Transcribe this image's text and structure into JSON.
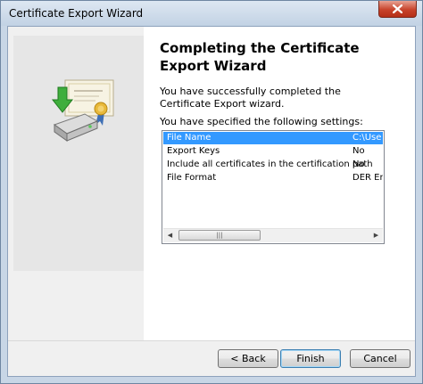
{
  "window": {
    "title": "Certificate Export Wizard"
  },
  "wizard": {
    "heading": "Completing the Certificate Export Wizard",
    "description": "You have successfully completed the Certificate Export wizard.",
    "settings_label": "You have specified the following settings:",
    "settings": [
      {
        "name": "File Name",
        "value": "C:\\Use"
      },
      {
        "name": "Export Keys",
        "value": "No"
      },
      {
        "name": "Include all certificates in the certification path",
        "value": "No"
      },
      {
        "name": "File Format",
        "value": "DER En"
      }
    ],
    "selected_row": 0,
    "scroll_thumb_grip": "|||"
  },
  "buttons": {
    "back": "< Back",
    "finish": "Finish",
    "cancel": "Cancel"
  },
  "icons": {
    "close": "close-icon",
    "wizard": "certificate-export-icon",
    "scroll_left": "left-arrow-icon",
    "scroll_right": "right-arrow-icon"
  },
  "colors": {
    "selection": "#3399ff",
    "close_button": "#c7432b",
    "panel": "#e6e6e6"
  }
}
